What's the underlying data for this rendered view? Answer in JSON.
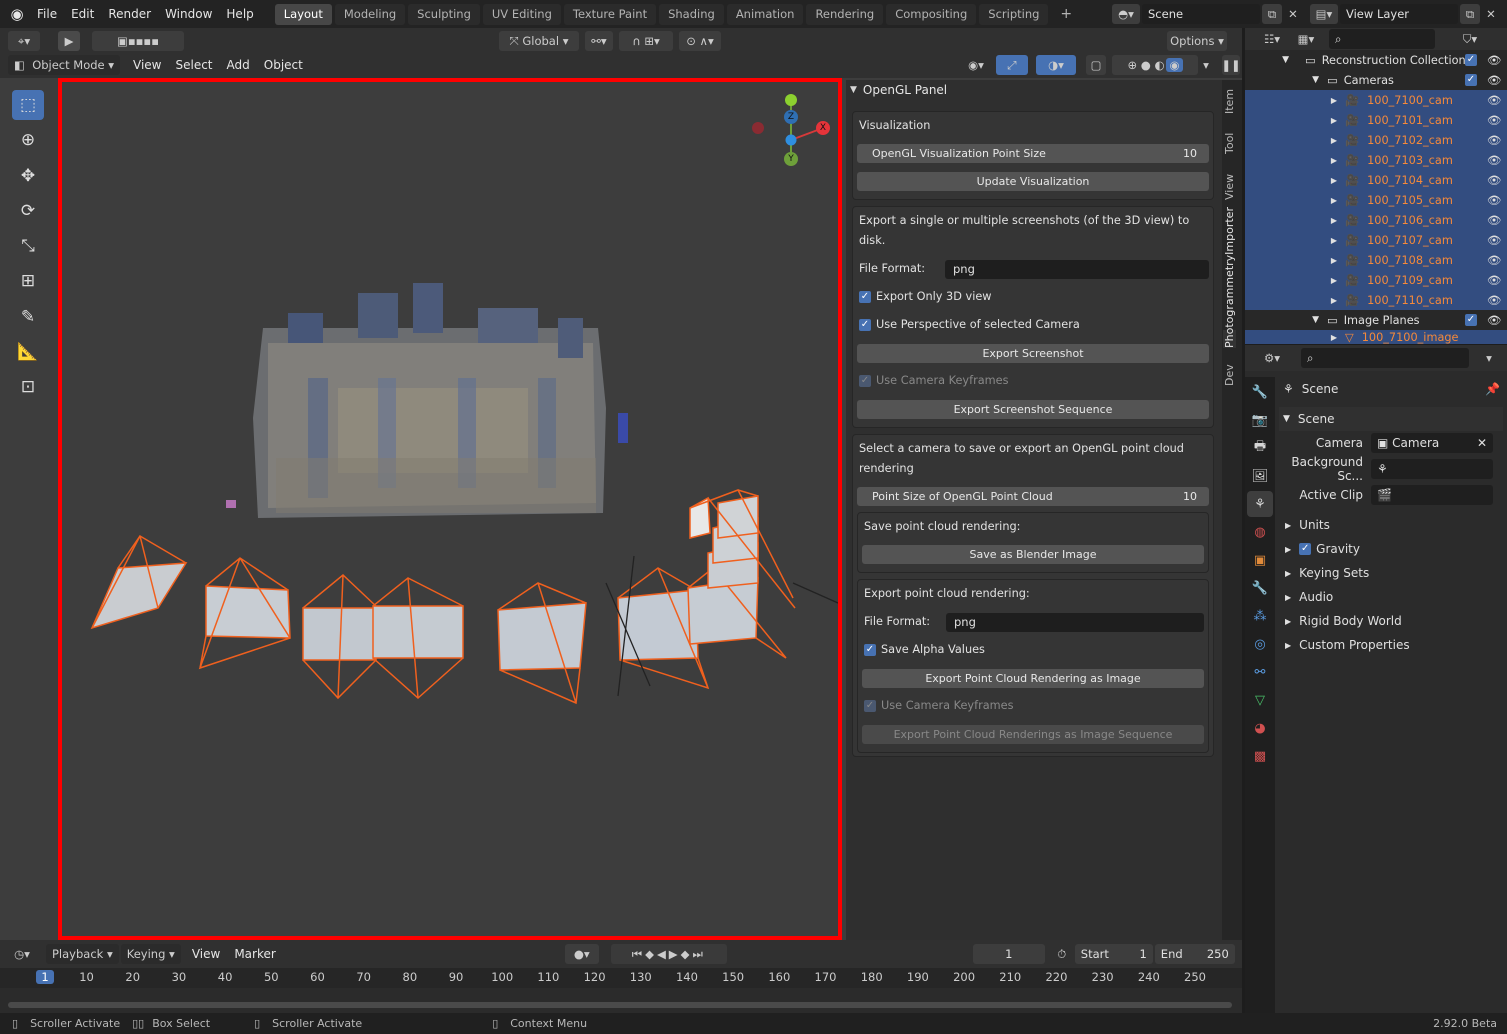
{
  "topbar": {
    "menus": [
      "File",
      "Edit",
      "Render",
      "Window",
      "Help"
    ],
    "workspaces": [
      "Layout",
      "Modeling",
      "Sculpting",
      "UV Editing",
      "Texture Paint",
      "Shading",
      "Animation",
      "Rendering",
      "Compositing",
      "Scripting"
    ],
    "active_workspace": "Layout",
    "scene": "Scene",
    "view_layer": "View Layer",
    "add_tab": "+"
  },
  "viewport": {
    "transform_orientation": "Global",
    "options_label": "Options",
    "mode": "Object Mode",
    "menus": [
      "View",
      "Select",
      "Add",
      "Object"
    ],
    "gizmo_axes": {
      "z": "Z",
      "x": "X",
      "y": "Y"
    }
  },
  "npanel": {
    "panel_title": "OpenGL Panel",
    "visualization_label": "Visualization",
    "point_size_label": "OpenGL Visualization Point Size",
    "point_size_value": "10",
    "update_button": "Update Visualization",
    "export_desc": "Export a single or multiple screenshots (of the 3D view) to disk.",
    "file_format_label": "File Format:",
    "file_format_value": "png",
    "export_only_3d": "Export Only 3D view",
    "use_perspective": "Use Perspective of selected Camera",
    "export_screenshot": "Export Screenshot",
    "use_camera_keyframes": "Use Camera Keyframes",
    "export_sequence": "Export Screenshot Sequence",
    "select_camera_desc": "Select a camera to save or export an OpenGL point cloud rendering",
    "pc_point_size_label": "Point Size of OpenGL Point Cloud",
    "pc_point_size_value": "10",
    "save_rendering_label": "Save point cloud rendering:",
    "save_blender_image": "Save as Blender Image",
    "export_rendering_label": "Export point cloud rendering:",
    "file_format_label2": "File Format:",
    "file_format_value2": "png",
    "save_alpha": "Save Alpha Values",
    "export_pc_image": "Export Point Cloud Rendering as Image",
    "use_camera_keyframes2": "Use Camera Keyframes",
    "export_pc_sequence": "Export Point Cloud Renderings as Image Sequence",
    "side_tabs": [
      "Item",
      "Tool",
      "View",
      "PhotogrammetryImporter",
      "Dev"
    ]
  },
  "outliner": {
    "reconstruction": "Reconstruction Collection",
    "cameras": "Cameras",
    "camera_items": [
      "100_7100_cam",
      "100_7101_cam",
      "100_7102_cam",
      "100_7103_cam",
      "100_7104_cam",
      "100_7105_cam",
      "100_7106_cam",
      "100_7107_cam",
      "100_7108_cam",
      "100_7109_cam",
      "100_7110_cam"
    ],
    "image_planes": "Image Planes",
    "image_item": "100_7100_image"
  },
  "properties": {
    "context": "Scene",
    "panel": "Scene",
    "camera_label": "Camera",
    "camera_value": "Camera",
    "background_label": "Background Sc...",
    "active_clip_label": "Active Clip",
    "sections": [
      "Units",
      "Gravity",
      "Keying Sets",
      "Audio",
      "Rigid Body World",
      "Custom Properties"
    ]
  },
  "timeline": {
    "menus": [
      "Playback",
      "Keying",
      "View",
      "Marker"
    ],
    "current_frame": "1",
    "start_label": "Start",
    "start_value": "1",
    "end_label": "End",
    "end_value": "250",
    "ruler": [
      "1",
      "10",
      "20",
      "30",
      "40",
      "50",
      "60",
      "70",
      "80",
      "90",
      "100",
      "110",
      "120",
      "130",
      "140",
      "150",
      "160",
      "170",
      "180",
      "190",
      "200",
      "210",
      "220",
      "230",
      "240",
      "250"
    ]
  },
  "statusbar": {
    "items": [
      "Scroller Activate",
      "Box Select",
      "Scroller Activate",
      "Context Menu"
    ],
    "version": "2.92.0 Beta"
  },
  "colors": {
    "accent": "#4772b3",
    "camera_orange": "#f5893a",
    "highlight_red": "#ff0000"
  }
}
